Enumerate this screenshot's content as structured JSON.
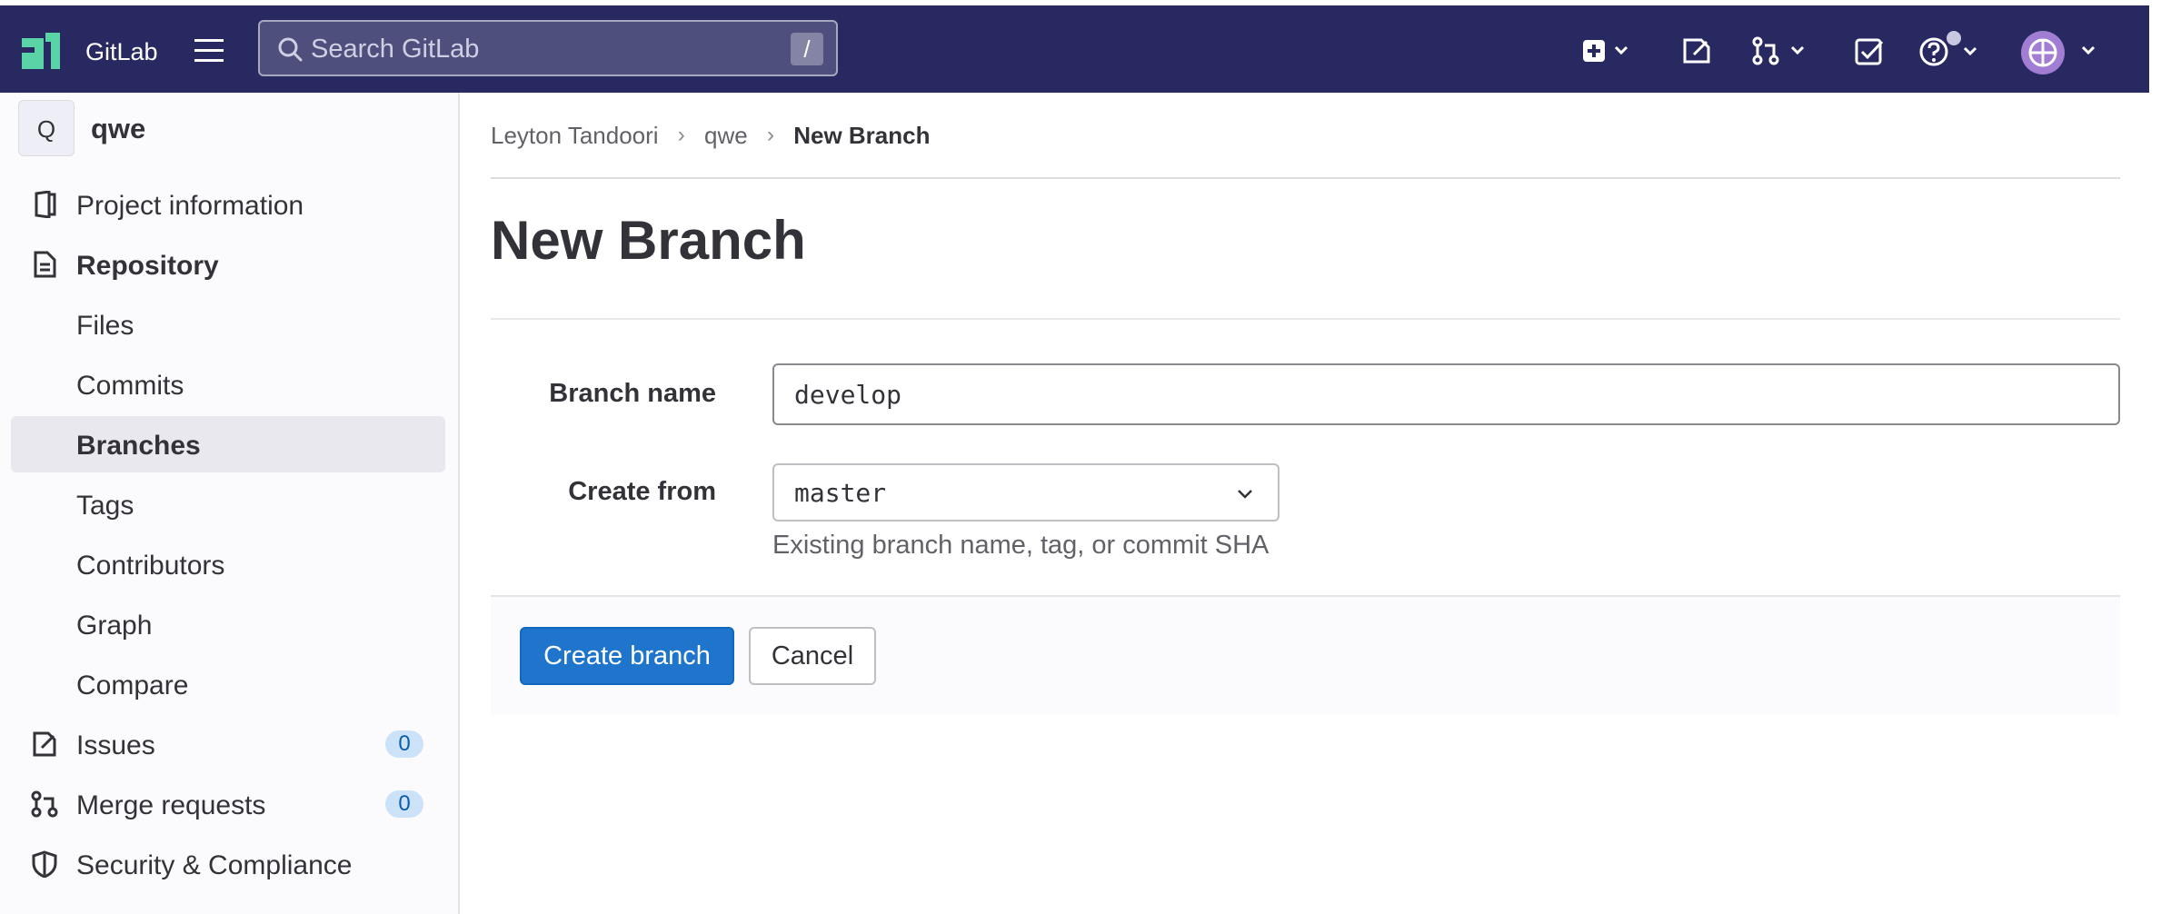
{
  "header": {
    "brand": "GitLab",
    "search_placeholder": "Search GitLab",
    "search_shortcut": "/"
  },
  "sidebar": {
    "project_avatar_letter": "Q",
    "project_name": "qwe",
    "items": [
      {
        "label": "Project information",
        "icon": "project-information-icon"
      },
      {
        "label": "Repository",
        "icon": "repository-icon"
      },
      {
        "label": "Files"
      },
      {
        "label": "Commits"
      },
      {
        "label": "Branches"
      },
      {
        "label": "Tags"
      },
      {
        "label": "Contributors"
      },
      {
        "label": "Graph"
      },
      {
        "label": "Compare"
      },
      {
        "label": "Issues",
        "icon": "issues-icon",
        "count": "0"
      },
      {
        "label": "Merge requests",
        "icon": "merge-request-icon",
        "count": "0"
      },
      {
        "label": "Security & Compliance",
        "icon": "shield-icon"
      }
    ]
  },
  "breadcrumb": [
    "Leyton Tandoori",
    "qwe",
    "New Branch"
  ],
  "page": {
    "title": "New Branch",
    "branch_name_label": "Branch name",
    "branch_name_value": "develop",
    "create_from_label": "Create from",
    "create_from_value": "master",
    "help_text": "Existing branch name, tag, or commit SHA",
    "create_button": "Create branch",
    "cancel_button": "Cancel"
  },
  "colors": {
    "topbar": "#292961",
    "primary": "#1f75cb",
    "logo": "#5ad3a6",
    "badge_bg": "#cbe2f9"
  }
}
